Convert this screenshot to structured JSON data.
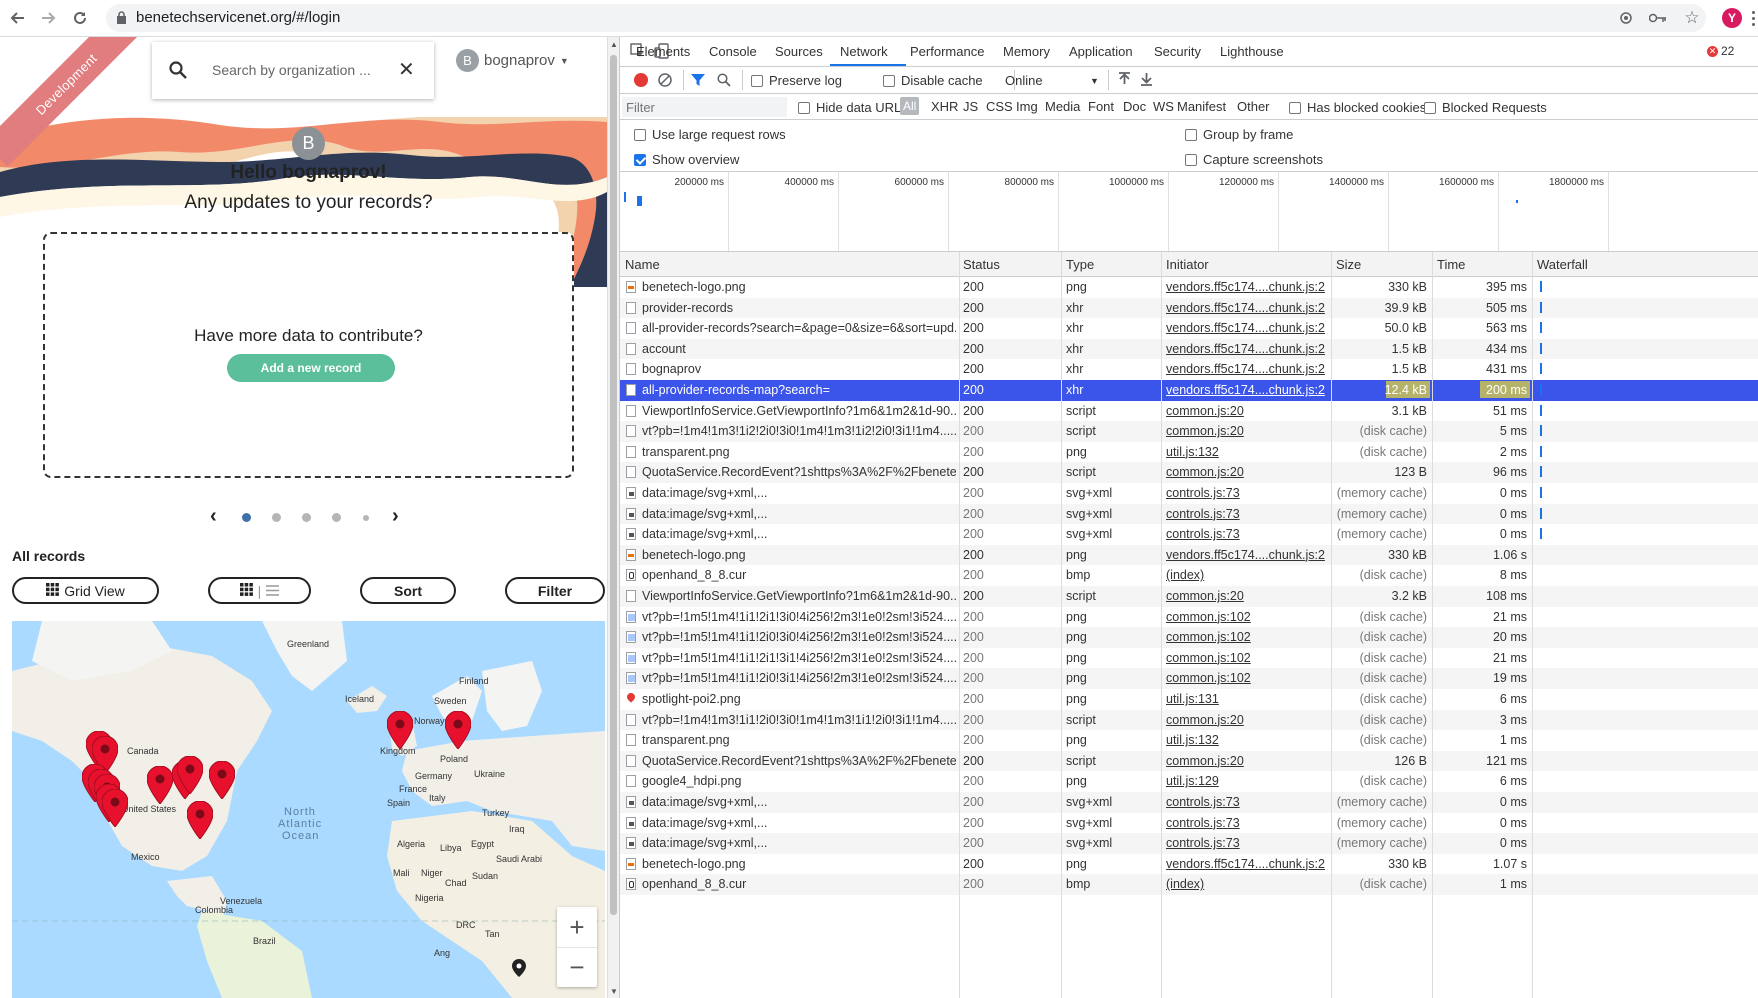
{
  "browser": {
    "url": "benetechservicenet.org/#/login",
    "profile_initial": "Y"
  },
  "web": {
    "ribbon": "Development",
    "search_placeholder": "Search by organization ...",
    "user": {
      "initial": "B",
      "name": "bognaprov"
    },
    "hello": "Hello bognaprov!",
    "updates": "Any updates to your records?",
    "contribute_question": "Have more data to contribute?",
    "add_record": "Add a new record",
    "all_records": "All records",
    "buttons": {
      "grid_view": "Grid View",
      "sort": "Sort",
      "filter": "Filter"
    },
    "map_labels": [
      {
        "text": "Greenland"
      },
      {
        "text": "Iceland"
      },
      {
        "text": "Finland"
      },
      {
        "text": "Sweden"
      },
      {
        "text": "Norway"
      },
      {
        "text": "Canada"
      },
      {
        "text": "Kingdom"
      },
      {
        "text": "Poland"
      },
      {
        "text": "Germany"
      },
      {
        "text": "Ukraine"
      },
      {
        "text": "France"
      },
      {
        "text": "Italy"
      },
      {
        "text": "Spain"
      },
      {
        "text": "Turkey"
      },
      {
        "text": "United States"
      },
      {
        "text": "North"
      },
      {
        "text": "Atlantic"
      },
      {
        "text": "Ocean"
      },
      {
        "text": "Iraq"
      },
      {
        "text": "Algeria"
      },
      {
        "text": "Libya"
      },
      {
        "text": "Egypt"
      },
      {
        "text": "Saudi Arabi"
      },
      {
        "text": "Mexico"
      },
      {
        "text": "Mali"
      },
      {
        "text": "Niger"
      },
      {
        "text": "Sudan"
      },
      {
        "text": "Chad"
      },
      {
        "text": "Nigeria"
      },
      {
        "text": "Venezuela"
      },
      {
        "text": "Colombia"
      },
      {
        "text": "DRC"
      },
      {
        "text": "Tan"
      },
      {
        "text": "Brazil"
      },
      {
        "text": "Ang"
      }
    ],
    "pin_count": 14
  },
  "devtools": {
    "tabs": [
      "Elements",
      "Console",
      "Sources",
      "Network",
      "Performance",
      "Memory",
      "Application",
      "Security",
      "Lighthouse"
    ],
    "active_tab": "Network",
    "error_count": "22",
    "toolbar": {
      "preserve_log": "Preserve log",
      "disable_cache": "Disable cache",
      "throttle": "Online"
    },
    "filter_placeholder": "Filter",
    "hide_data_urls": "Hide data URLs",
    "types": [
      "All",
      "XHR",
      "JS",
      "CSS",
      "Img",
      "Media",
      "Font",
      "Doc",
      "WS",
      "Manifest",
      "Other"
    ],
    "has_blocked_cookies": "Has blocked cookies",
    "blocked_requests": "Blocked Requests",
    "settings": {
      "large_rows": "Use large request rows",
      "show_overview": "Show overview",
      "group_by_frame": "Group by frame",
      "capture_screenshots": "Capture screenshots"
    }
  },
  "network": {
    "overview_ticks": [
      "200000 ms",
      "400000 ms",
      "600000 ms",
      "800000 ms",
      "1000000 ms",
      "1200000 ms",
      "1400000 ms",
      "1600000 ms",
      "1800000 ms"
    ],
    "columns": [
      "Name",
      "Status",
      "Type",
      "Initiator",
      "Size",
      "Time",
      "Waterfall"
    ],
    "rows": [
      {
        "name": "benetech-logo.png",
        "status": "200",
        "type": "png",
        "initiator": "vendors.ff5c174....chunk.js:2",
        "size": "330 kB",
        "time": "395 ms",
        "icon": "img"
      },
      {
        "name": "provider-records",
        "status": "200",
        "type": "xhr",
        "initiator": "vendors.ff5c174....chunk.js:2",
        "size": "39.9 kB",
        "time": "505 ms",
        "icon": "doc"
      },
      {
        "name": "all-provider-records?search=&page=0&size=6&sort=upd...",
        "status": "200",
        "type": "xhr",
        "initiator": "vendors.ff5c174....chunk.js:2",
        "size": "50.0 kB",
        "time": "563 ms",
        "icon": "doc"
      },
      {
        "name": "account",
        "status": "200",
        "type": "xhr",
        "initiator": "vendors.ff5c174....chunk.js:2",
        "size": "1.5 kB",
        "time": "434 ms",
        "icon": "doc"
      },
      {
        "name": "bognaprov",
        "status": "200",
        "type": "xhr",
        "initiator": "vendors.ff5c174....chunk.js:2",
        "size": "1.5 kB",
        "time": "431 ms",
        "icon": "doc"
      },
      {
        "name": "all-provider-records-map?search=",
        "status": "200",
        "type": "xhr",
        "initiator": "vendors.ff5c174....chunk.js:2",
        "size": "12.4 kB",
        "time": "200 ms",
        "icon": "doc",
        "selected": true
      },
      {
        "name": "ViewportInfoService.GetViewportInfo?1m6&1m2&1d-90...",
        "status": "200",
        "type": "script",
        "initiator": "common.js:20",
        "size": "3.1 kB",
        "time": "51 ms",
        "icon": "doc"
      },
      {
        "name": "vt?pb=!1m4!1m3!1i2!2i0!3i0!1m4!1m3!1i2!2i0!3i1!1m4......",
        "status": "200",
        "type": "script",
        "initiator": "common.js:20",
        "size": "(disk cache)",
        "time": "5 ms",
        "icon": "doc",
        "cached": true
      },
      {
        "name": "transparent.png",
        "status": "200",
        "type": "png",
        "initiator": "util.js:132",
        "size": "(disk cache)",
        "time": "2 ms",
        "icon": "doc",
        "cached": true
      },
      {
        "name": "QuotaService.RecordEvent?1shttps%3A%2F%2Fbenete...",
        "status": "200",
        "type": "script",
        "initiator": "common.js:20",
        "size": "123 B",
        "time": "96 ms",
        "icon": "doc"
      },
      {
        "name": "data:image/svg+xml,...",
        "status": "200",
        "type": "svg+xml",
        "initiator": "controls.js:73",
        "size": "(memory cache)",
        "time": "0 ms",
        "icon": "svg",
        "cached": true
      },
      {
        "name": "data:image/svg+xml,...",
        "status": "200",
        "type": "svg+xml",
        "initiator": "controls.js:73",
        "size": "(memory cache)",
        "time": "0 ms",
        "icon": "svg",
        "cached": true
      },
      {
        "name": "data:image/svg+xml,...",
        "status": "200",
        "type": "svg+xml",
        "initiator": "controls.js:73",
        "size": "(memory cache)",
        "time": "0 ms",
        "icon": "svg",
        "cached": true
      },
      {
        "name": "benetech-logo.png",
        "status": "200",
        "type": "png",
        "initiator": "vendors.ff5c174....chunk.js:2",
        "size": "330 kB",
        "time": "1.06 s",
        "icon": "img"
      },
      {
        "name": "openhand_8_8.cur",
        "status": "200",
        "type": "bmp",
        "initiator": "(index)",
        "size": "(disk cache)",
        "time": "8 ms",
        "icon": "cur",
        "cached": true
      },
      {
        "name": "ViewportInfoService.GetViewportInfo?1m6&1m2&1d-90...",
        "status": "200",
        "type": "script",
        "initiator": "common.js:20",
        "size": "3.2 kB",
        "time": "108 ms",
        "icon": "doc"
      },
      {
        "name": "vt?pb=!1m5!1m4!1i1!2i1!3i0!4i256!2m3!1e0!2sm!3i524......",
        "status": "200",
        "type": "png",
        "initiator": "common.js:102",
        "size": "(disk cache)",
        "time": "21 ms",
        "icon": "vt",
        "cached": true
      },
      {
        "name": "vt?pb=!1m5!1m4!1i1!2i0!3i0!4i256!2m3!1e0!2sm!3i524......",
        "status": "200",
        "type": "png",
        "initiator": "common.js:102",
        "size": "(disk cache)",
        "time": "20 ms",
        "icon": "vt",
        "cached": true
      },
      {
        "name": "vt?pb=!1m5!1m4!1i1!2i1!3i1!4i256!2m3!1e0!2sm!3i524......",
        "status": "200",
        "type": "png",
        "initiator": "common.js:102",
        "size": "(disk cache)",
        "time": "21 ms",
        "icon": "vt",
        "cached": true
      },
      {
        "name": "vt?pb=!1m5!1m4!1i1!2i0!3i1!4i256!2m3!1e0!2sm!3i524......",
        "status": "200",
        "type": "png",
        "initiator": "common.js:102",
        "size": "(disk cache)",
        "time": "19 ms",
        "icon": "vt",
        "cached": true
      },
      {
        "name": "spotlight-poi2.png",
        "status": "200",
        "type": "png",
        "initiator": "util.js:131",
        "size": "(disk cache)",
        "time": "6 ms",
        "icon": "pin",
        "cached": true
      },
      {
        "name": "vt?pb=!1m4!1m3!1i1!2i0!3i0!1m4!1m3!1i1!2i0!3i1!1m4......",
        "status": "200",
        "type": "script",
        "initiator": "common.js:20",
        "size": "(disk cache)",
        "time": "3 ms",
        "icon": "doc",
        "cached": true
      },
      {
        "name": "transparent.png",
        "status": "200",
        "type": "png",
        "initiator": "util.js:132",
        "size": "(disk cache)",
        "time": "1 ms",
        "icon": "doc",
        "cached": true
      },
      {
        "name": "QuotaService.RecordEvent?1shttps%3A%2F%2Fbenete...",
        "status": "200",
        "type": "script",
        "initiator": "common.js:20",
        "size": "126 B",
        "time": "121 ms",
        "icon": "doc"
      },
      {
        "name": "google4_hdpi.png",
        "status": "200",
        "type": "png",
        "initiator": "util.js:129",
        "size": "(disk cache)",
        "time": "6 ms",
        "icon": "doc",
        "cached": true
      },
      {
        "name": "data:image/svg+xml,...",
        "status": "200",
        "type": "svg+xml",
        "initiator": "controls.js:73",
        "size": "(memory cache)",
        "time": "0 ms",
        "icon": "svg",
        "cached": true
      },
      {
        "name": "data:image/svg+xml,...",
        "status": "200",
        "type": "svg+xml",
        "initiator": "controls.js:73",
        "size": "(memory cache)",
        "time": "0 ms",
        "icon": "svg",
        "cached": true
      },
      {
        "name": "data:image/svg+xml,...",
        "status": "200",
        "type": "svg+xml",
        "initiator": "controls.js:73",
        "size": "(memory cache)",
        "time": "0 ms",
        "icon": "svg",
        "cached": true
      },
      {
        "name": "benetech-logo.png",
        "status": "200",
        "type": "png",
        "initiator": "vendors.ff5c174....chunk.js:2",
        "size": "330 kB",
        "time": "1.07 s",
        "icon": "img"
      },
      {
        "name": "openhand_8_8.cur",
        "status": "200",
        "type": "bmp",
        "initiator": "(index)",
        "size": "(disk cache)",
        "time": "1 ms",
        "icon": "cur",
        "cached": true
      }
    ]
  }
}
